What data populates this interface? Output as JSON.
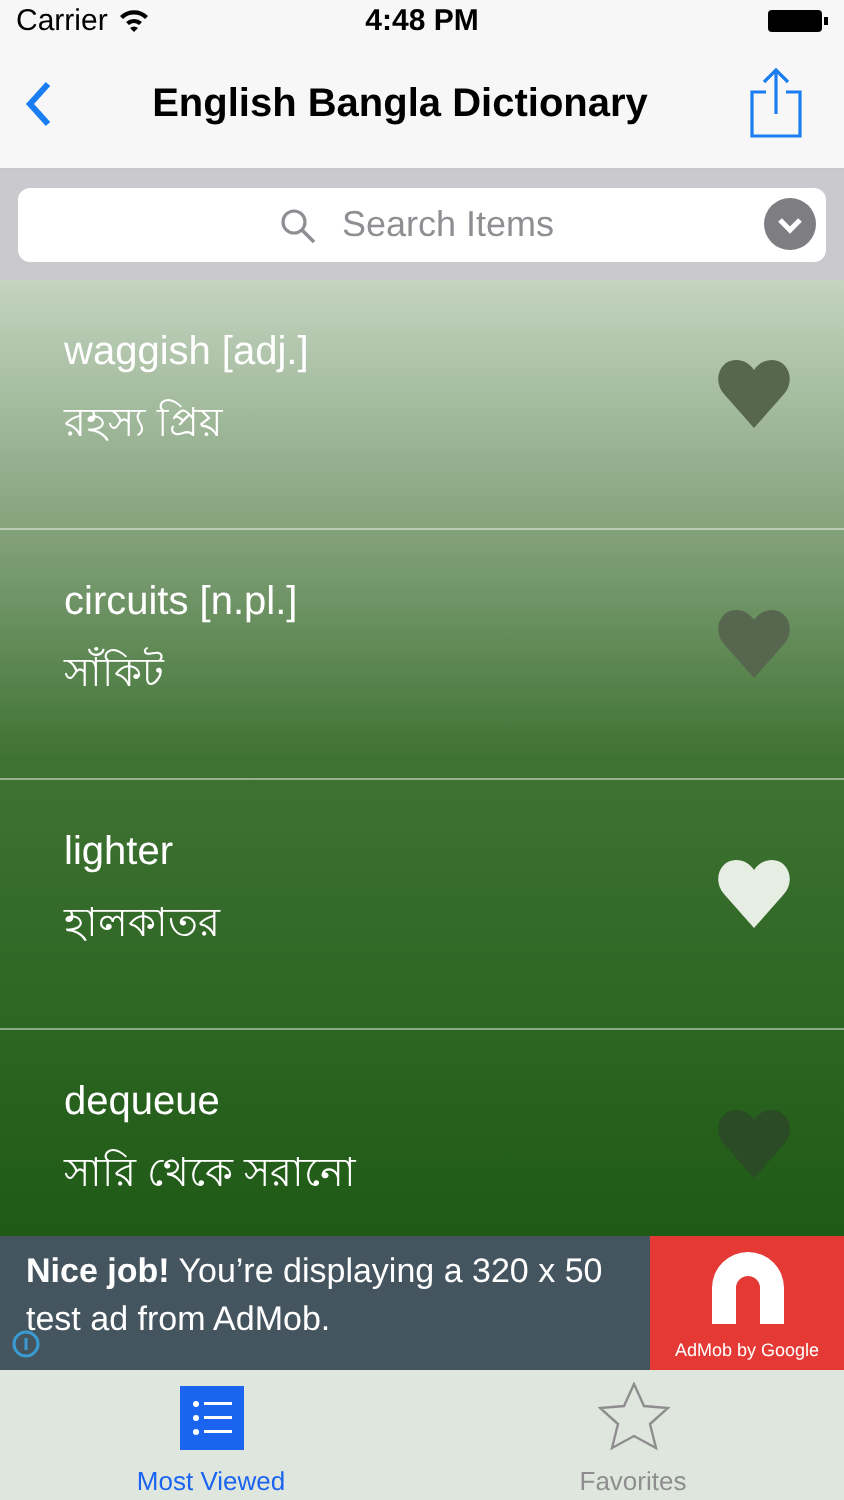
{
  "status_bar": {
    "carrier": "Carrier",
    "time": "4:48 PM"
  },
  "nav": {
    "title": "English Bangla Dictionary"
  },
  "search": {
    "placeholder": "Search Items"
  },
  "entries": [
    {
      "word": "waggish [adj.]",
      "meaning": "রহস্য প্রিয়",
      "favorite": false
    },
    {
      "word": "circuits [n.pl.]",
      "meaning": "সাঁকিট",
      "favorite": false
    },
    {
      "word": "lighter",
      "meaning": "হালকাতর",
      "favorite": true
    },
    {
      "word": "dequeue",
      "meaning": "সারি থেকে সরানো",
      "favorite": false
    }
  ],
  "ad": {
    "text": "**Nice job!** You’re displaying a 320 x 50 test ad from AdMob.",
    "brand": "AdMob by Google"
  },
  "tabs": [
    {
      "label": "Most Viewed",
      "selected": true
    },
    {
      "label": "Favorites",
      "selected": false
    }
  ]
}
